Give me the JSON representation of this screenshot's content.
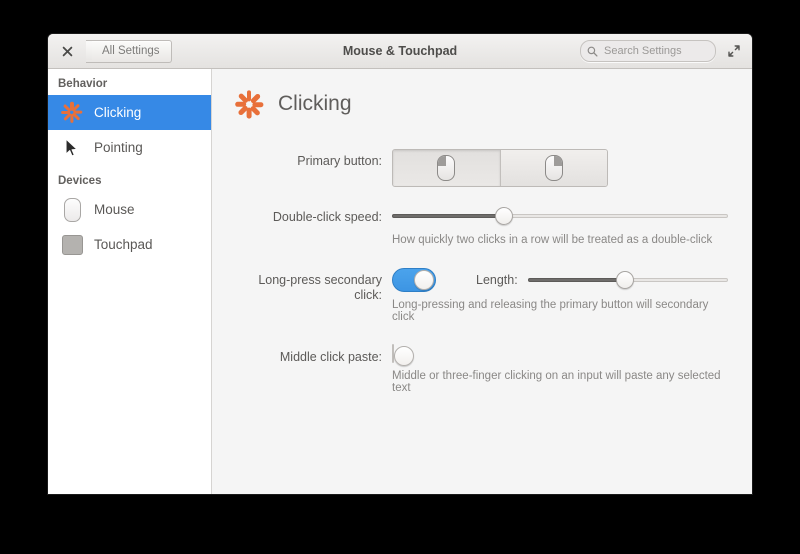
{
  "window": {
    "title": "Mouse & Touchpad",
    "close_label": "✕",
    "back_label": "All Settings",
    "maximize_icon": "maximize-icon"
  },
  "search": {
    "placeholder": "Search Settings",
    "value": "",
    "icon": "search-icon"
  },
  "sidebar": {
    "sections": [
      {
        "header": "Behavior",
        "items": [
          {
            "label": "Clicking",
            "icon": "clicking-spinner-icon",
            "selected": true
          },
          {
            "label": "Pointing",
            "icon": "cursor-arrow-icon",
            "selected": false
          }
        ]
      },
      {
        "header": "Devices",
        "items": [
          {
            "label": "Mouse",
            "icon": "mouse-icon",
            "selected": false
          },
          {
            "label": "Touchpad",
            "icon": "touchpad-icon",
            "selected": false
          }
        ]
      }
    ]
  },
  "page": {
    "title": "Clicking",
    "icon": "clicking-spinner-icon"
  },
  "settings": {
    "primary_button": {
      "label": "Primary button:",
      "options": [
        {
          "name": "left",
          "icon": "mouse-left-button-icon",
          "selected": true
        },
        {
          "name": "right",
          "icon": "mouse-right-button-icon",
          "selected": false
        }
      ]
    },
    "double_click_speed": {
      "label": "Double-click speed:",
      "hint": "How quickly two clicks in a row will be treated as a double-click",
      "percent": 33
    },
    "long_press": {
      "label": "Long-press secondary click:",
      "hint": "Long-pressing and releasing the primary button will secondary click",
      "enabled": true,
      "length_label": "Length:",
      "length_percent": 48
    },
    "middle_click_paste": {
      "label": "Middle click paste:",
      "hint": "Middle or three-finger clicking on an input will paste any selected text",
      "enabled": false
    }
  },
  "colors": {
    "accent_blue": "#3689e6",
    "toggle_blue": "#4ba3ec",
    "spinner_orange": "#e8703a",
    "sidebar_bg": "#ffffff",
    "content_bg": "#f5f5f5"
  }
}
